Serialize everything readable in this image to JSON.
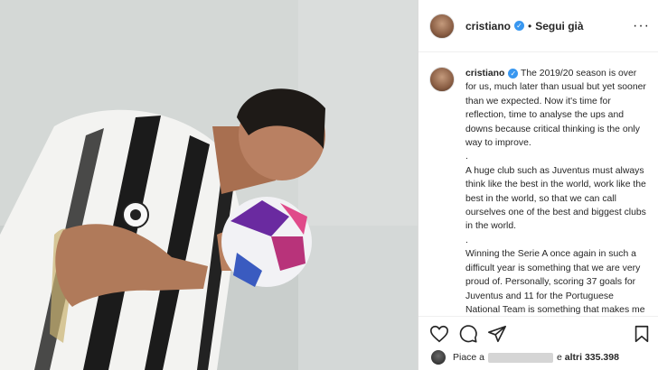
{
  "post": {
    "username": "cristiano",
    "follow_label": "Segui già",
    "separator": "•",
    "more_label": "···",
    "verified_symbol": "✓"
  },
  "caption": {
    "username": "cristiano",
    "text": " The 2019/20 season is over for us, much later than usual but yet sooner than we expected. Now it's time for reflection, time to analyse the ups and downs because critical thinking is the only way to improve.\n.\nA huge club such as Juventus must always think like the best in the world, work like the best in the world, so that we can call ourselves one of the best and biggest clubs in the world.\n.\nWinning the Serie A once again in such a difficult year is something that we are very proud of. Personally, scoring 37 goals for Juventus and 11 for the Portuguese National Team is something that makes me feel the"
  },
  "likes": {
    "prefix": "Piace a",
    "middle": "e",
    "others": "altri 335.398"
  },
  "icons": [
    "heart-icon",
    "comment-icon",
    "share-icon",
    "bookmark-icon",
    "verified-icon",
    "more-icon"
  ],
  "colors": {
    "verified": "#3897f0",
    "text": "#262626",
    "border": "#dbdbdb"
  }
}
